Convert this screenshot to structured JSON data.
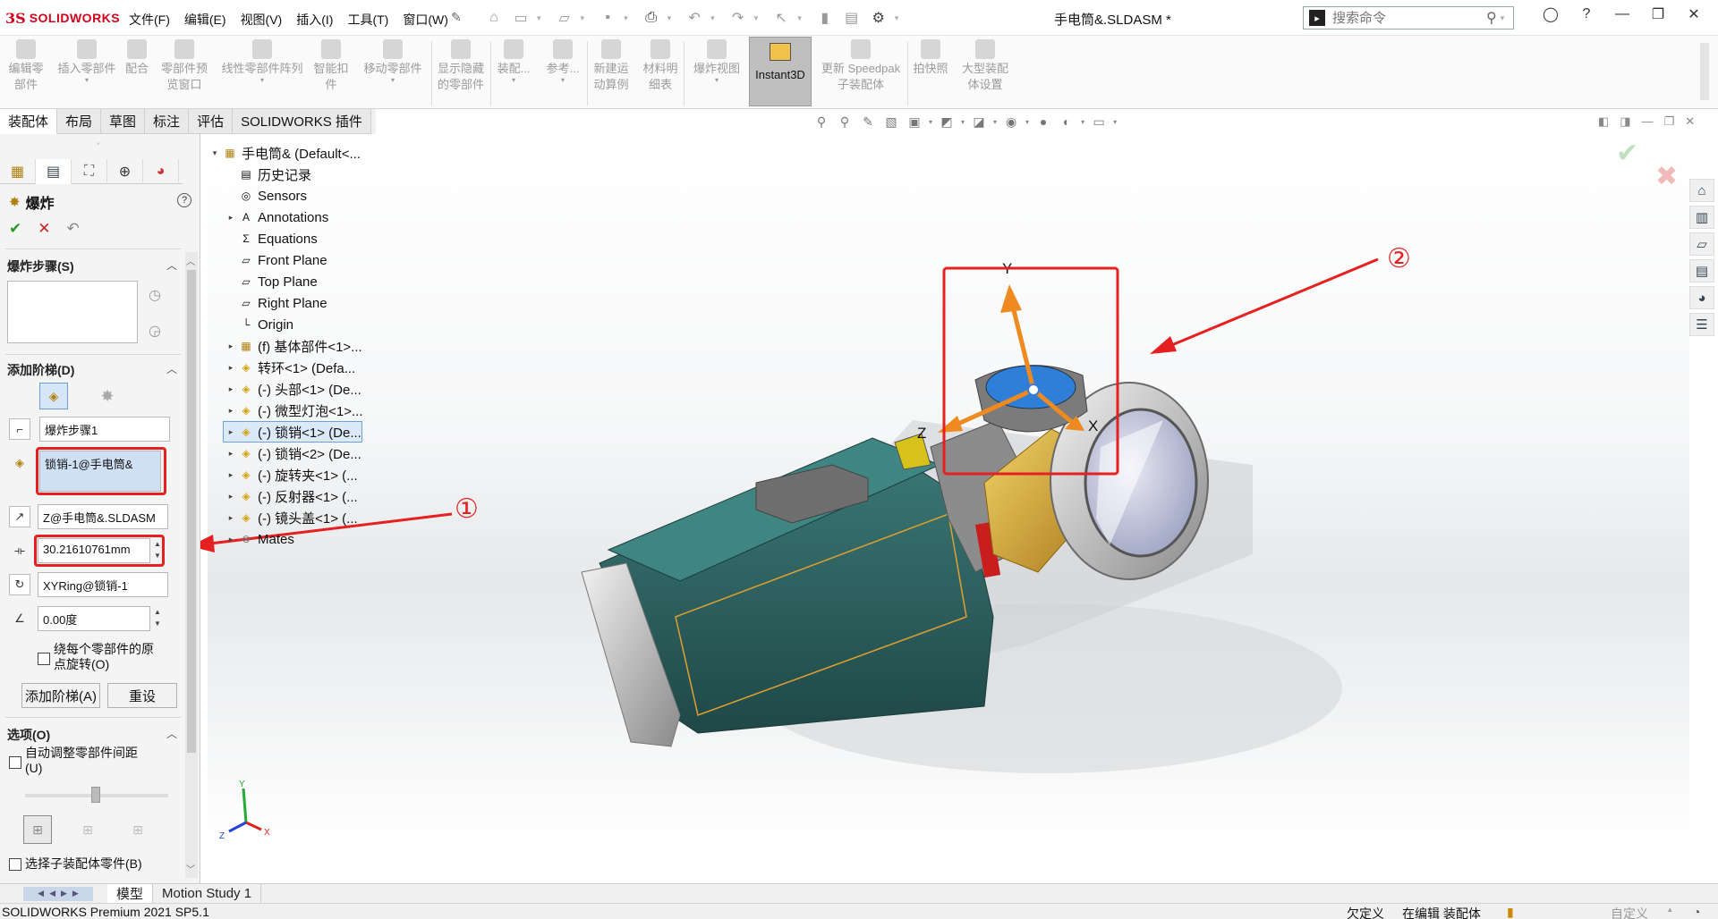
{
  "app": {
    "brand": "SOLIDWORKS",
    "document_title": "手电筒&.SLDASM *"
  },
  "menu": [
    "文件(F)",
    "编辑(E)",
    "视图(V)",
    "插入(I)",
    "工具(T)",
    "窗口(W)"
  ],
  "search": {
    "placeholder": "搜索命令"
  },
  "toolbar": {
    "items": [
      {
        "label": "编辑零\n部件"
      },
      {
        "label": "插入零部件"
      },
      {
        "label": "配合"
      },
      {
        "label": "零部件预\n览窗口"
      },
      {
        "label": "线性零部件阵列"
      },
      {
        "label": "智能扣\n件"
      },
      {
        "label": "移动零部件"
      },
      {
        "label": "显示隐藏\n的零部件"
      },
      {
        "label": "装配..."
      },
      {
        "label": "参考..."
      },
      {
        "label": "新建运\n动算例"
      },
      {
        "label": "材料明\n细表"
      },
      {
        "label": "爆炸视图"
      },
      {
        "label": "更新 Speedpak\n子装配体"
      },
      {
        "label": "拍快照"
      },
      {
        "label": "大型装配\n体设置"
      }
    ],
    "instant3d_label": "Instant3D"
  },
  "tabs": [
    "装配体",
    "布局",
    "草图",
    "标注",
    "评估",
    "SOLIDWORKS 插件"
  ],
  "property_manager": {
    "title": "爆炸",
    "help": "?",
    "sections": {
      "explode_steps": "爆炸步骤(S)",
      "add_step": "添加阶梯(D)",
      "options": "选项(O)"
    },
    "step_name": "爆炸步骤1",
    "component": "锁销-1@手电筒&",
    "direction": "Z@手电筒&.SLDASM",
    "distance": "30.21610761mm",
    "rotation_axis": "XYRing@锁销-1",
    "angle": "0.00度",
    "rotate_about_origin_label": "绕每个零部件的原\n点旋转(O)",
    "rotate_about_origin_checked": false,
    "add_step_button": "添加阶梯(A)",
    "reset_button": "重设",
    "auto_space_label": "自动调整零部件间距\n(U)",
    "auto_space_checked": false,
    "select_subassembly_label": "选择子装配体零件(B)",
    "select_subassembly_checked": false
  },
  "feature_tree": [
    {
      "label": "手电筒& (Default<...",
      "icon": "assembly-icon",
      "expander": "▾",
      "level": 0
    },
    {
      "label": "历史记录",
      "icon": "history-icon",
      "expander": "",
      "level": 1
    },
    {
      "label": "Sensors",
      "icon": "sensors-icon",
      "expander": "",
      "level": 1
    },
    {
      "label": "Annotations",
      "icon": "annotations-icon",
      "expander": "▸",
      "level": 1
    },
    {
      "label": "Equations",
      "icon": "equations-icon",
      "expander": "",
      "level": 1
    },
    {
      "label": "Front Plane",
      "icon": "plane-icon",
      "expander": "",
      "level": 1
    },
    {
      "label": "Top Plane",
      "icon": "plane-icon",
      "expander": "",
      "level": 1
    },
    {
      "label": "Right Plane",
      "icon": "plane-icon",
      "expander": "",
      "level": 1
    },
    {
      "label": "Origin",
      "icon": "origin-icon",
      "expander": "",
      "level": 1
    },
    {
      "label": "(f) 基体部件<1>...",
      "icon": "subassembly-icon",
      "expander": "▸",
      "level": 1
    },
    {
      "label": "转环<1> (Defa...",
      "icon": "part-icon",
      "expander": "▸",
      "level": 1
    },
    {
      "label": "(-) 头部<1> (De...",
      "icon": "part-icon",
      "expander": "▸",
      "level": 1
    },
    {
      "label": "(-) 微型灯泡<1>...",
      "icon": "part-icon",
      "expander": "▸",
      "level": 1
    },
    {
      "label": "(-) 锁销<1> (De...",
      "icon": "part-icon",
      "expander": "▸",
      "level": 1,
      "selected": true
    },
    {
      "label": "(-) 锁销<2> (De...",
      "icon": "part-icon",
      "expander": "▸",
      "level": 1
    },
    {
      "label": "(-) 旋转夹<1> (...",
      "icon": "part-icon",
      "expander": "▸",
      "level": 1
    },
    {
      "label": "(-) 反射器<1> (...",
      "icon": "part-icon",
      "expander": "▸",
      "level": 1
    },
    {
      "label": "(-) 镜头盖<1> (...",
      "icon": "part-icon",
      "expander": "▸",
      "level": 1
    },
    {
      "label": "Mates",
      "icon": "mates-icon",
      "expander": "▸",
      "level": 1
    }
  ],
  "triad": {
    "x": "X",
    "y": "Y",
    "z": "Z"
  },
  "annotations": {
    "one": "①",
    "two": "②"
  },
  "bottom_tabs": [
    "模型",
    "Motion Study 1"
  ],
  "status": {
    "version": "SOLIDWORKS Premium 2021 SP5.1",
    "underdefined": "欠定义",
    "editing": "在编辑 装配体",
    "custom": "自定义"
  },
  "colors": {
    "annotation_red": "#e52020",
    "triad_orange": "#ee8a1f",
    "body_teal": "#2f5f5e",
    "lens_blue": "#2f7fd9",
    "brass": "#d6a52a"
  }
}
